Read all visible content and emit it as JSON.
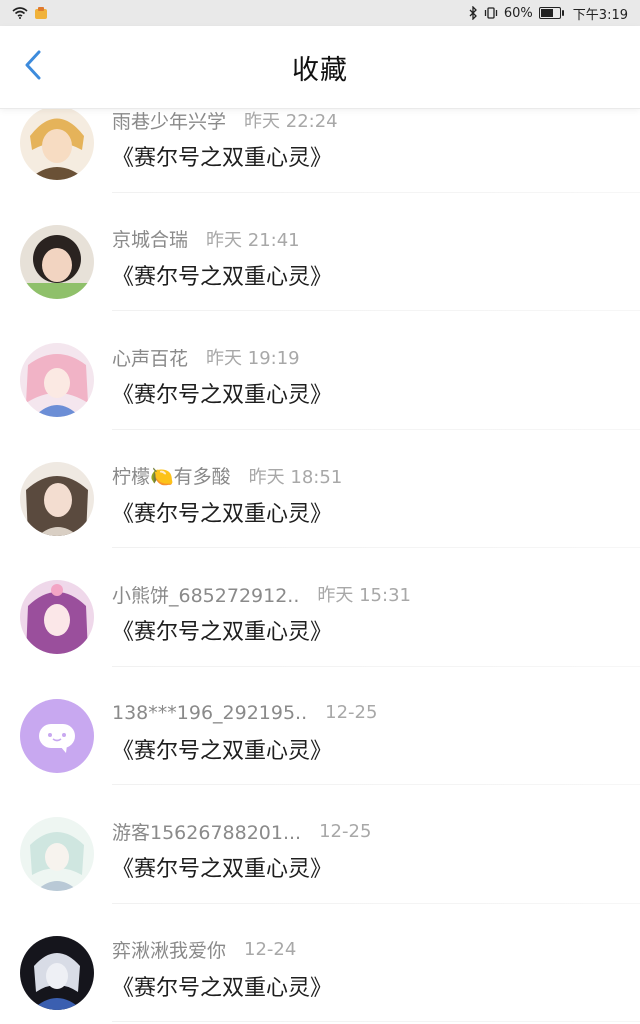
{
  "status_bar": {
    "battery_percent": "60%",
    "time": "下午3:19"
  },
  "header": {
    "title": "收藏"
  },
  "favorites": [
    {
      "username": "雨巷少年兴学",
      "time": "昨天 22:24",
      "title": "《赛尔号之双重心灵》"
    },
    {
      "username": "京城合瑞",
      "time": "昨天 21:41",
      "title": "《赛尔号之双重心灵》"
    },
    {
      "username": "心声百花",
      "time": "昨天 19:19",
      "title": "《赛尔号之双重心灵》"
    },
    {
      "username": "柠檬🍋有多酸",
      "time": "昨天 18:51",
      "title": "《赛尔号之双重心灵》"
    },
    {
      "username": "小熊饼_685272912..",
      "time": "昨天 15:31",
      "title": "《赛尔号之双重心灵》"
    },
    {
      "username": "138***196_292195..",
      "time": "12-25",
      "title": "《赛尔号之双重心灵》"
    },
    {
      "username": "游客15626788201...",
      "time": "12-25",
      "title": "《赛尔号之双重心灵》"
    },
    {
      "username": "弈湫湫我爱你",
      "time": "12-24",
      "title": "《赛尔号之双重心灵》"
    }
  ],
  "colors": {
    "accent_back_arrow": "#3d8bdc",
    "default_avatar_bg": "#c8a8f0"
  }
}
